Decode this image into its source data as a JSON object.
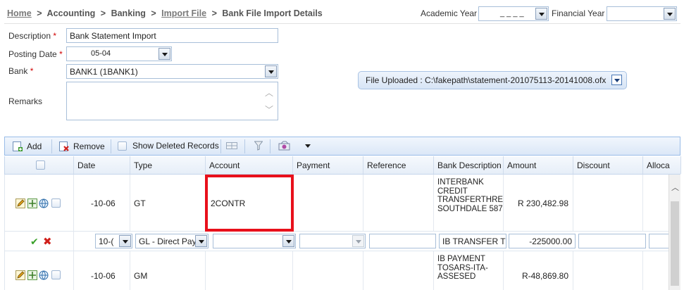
{
  "breadcrumb": {
    "home": "Home",
    "accounting": "Accounting",
    "banking": "Banking",
    "import_file": "Import File",
    "current": "Bank File Import Details",
    "sep": ">"
  },
  "header": {
    "academic_year_label": "Academic Year",
    "academic_year_value": "_ _ _ _",
    "financial_year_label": "Financial Year",
    "financial_year_value": ""
  },
  "form": {
    "description_label": "Description",
    "description_value": "Bank Statement Import",
    "posting_date_label": "Posting Date",
    "posting_date_value": "05-04",
    "bank_label": "Bank",
    "bank_value": "BANK1 (1BANK1)",
    "remarks_label": "Remarks",
    "remarks_value": "",
    "required_mark": "*"
  },
  "file_upload": {
    "text": "File Uploaded : C:\\fakepath\\statement-201075113-20141008.ofx"
  },
  "toolbar": {
    "add": "Add",
    "remove": "Remove",
    "show_deleted": "Show Deleted Records"
  },
  "grid": {
    "columns": [
      "",
      "Date",
      "Type",
      "Account",
      "Payment",
      "Reference",
      "Bank Description",
      "Amount",
      "Discount",
      "Alloca"
    ],
    "rows": [
      {
        "date": "-10-06",
        "type": "GT",
        "account": "2CONTR",
        "payment": "",
        "reference": "",
        "bank_description": "INTERBANK CREDIT TRANSFERTHREE SOUTHDALE 587",
        "amount": "R 230,482.98",
        "discount": ""
      },
      {
        "date": "10-(",
        "type": "GL - Direct Pay",
        "account": "",
        "payment": "",
        "reference": "",
        "bank_description": "IB TRANSFER TC",
        "amount": "-225000.00",
        "discount": ""
      },
      {
        "date": "-10-06",
        "type": "GM",
        "account": "",
        "payment": "",
        "reference": "",
        "bank_description": "IB PAYMENT TOSARS-ITA-ASSESED",
        "amount": "R-48,869.80",
        "discount": ""
      }
    ]
  },
  "colors": {
    "highlight": "#e8101b",
    "link": "#7a7a7a",
    "required": "#d00000",
    "toolbar_border": "#99bce8"
  }
}
